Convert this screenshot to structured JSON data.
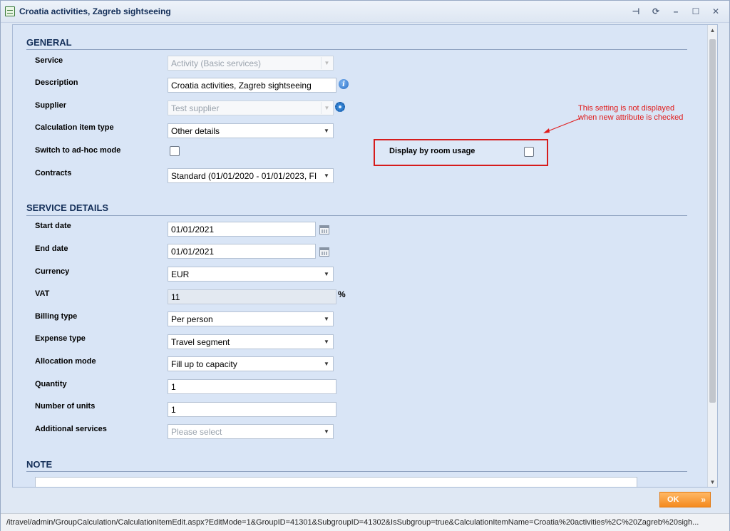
{
  "window": {
    "title": "Croatia activities, Zagreb sightseeing"
  },
  "sections": {
    "general": "GENERAL",
    "service_details": "SERVICE DETAILS",
    "note": "NOTE"
  },
  "general": {
    "service_label": "Service",
    "service_value": "Activity (Basic services)",
    "description_label": "Description",
    "description_value": "Croatia activities, Zagreb sightseeing",
    "supplier_label": "Supplier",
    "supplier_value": "Test supplier",
    "calc_item_type_label": "Calculation item type",
    "calc_item_type_value": "Other details",
    "adhoc_label": "Switch to ad-hoc mode",
    "contracts_label": "Contracts",
    "contracts_value": "Standard (01/01/2020 - 01/01/2023, FI",
    "display_room_label": "Display by room usage"
  },
  "annotation": {
    "line1": "This setting is not displayed",
    "line2": "when new attribute is checked",
    "color": "#e01b1b"
  },
  "details": {
    "start_date_label": "Start date",
    "start_date_value": "01/01/2021",
    "end_date_label": "End date",
    "end_date_value": "01/01/2021",
    "currency_label": "Currency",
    "currency_value": "EUR",
    "vat_label": "VAT",
    "vat_value": "11",
    "vat_unit": "%",
    "billing_label": "Billing type",
    "billing_value": "Per person",
    "expense_label": "Expense type",
    "expense_value": "Travel segment",
    "allocation_label": "Allocation mode",
    "allocation_value": "Fill up to capacity",
    "quantity_label": "Quantity",
    "quantity_value": "1",
    "units_label": "Number of units",
    "units_value": "1",
    "additional_label": "Additional services",
    "additional_placeholder": "Please select"
  },
  "footer": {
    "ok_label": "OK",
    "ok_chevrons": "»"
  },
  "statusbar": {
    "url": "/itravel/admin/GroupCalculation/CalculationItemEdit.aspx?EditMode=1&GroupID=41301&SubgroupID=41302&IsSubgroup=true&CalculationItemName=Croatia%20activities%2C%20Zagreb%20sigh..."
  },
  "colors": {
    "accent": "#15305a",
    "ok_button": "#f48a1e",
    "highlight": "#d61c1c"
  }
}
